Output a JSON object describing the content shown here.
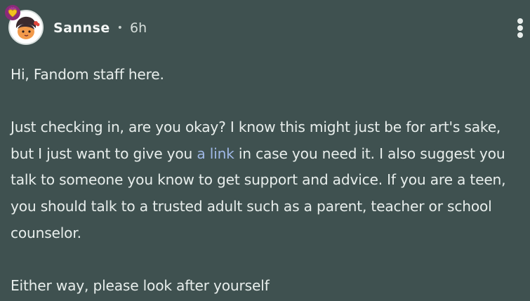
{
  "post": {
    "username": "Sannse",
    "separator": "•",
    "time_ago": "6h",
    "more_icon": "more-vertical-icon",
    "avatar_icon": "avatar-character-icon",
    "badge_icon": "heart-badge-icon",
    "colors": {
      "background": "#3f5150",
      "text": "#e8eeec",
      "link": "#9fb8e6",
      "badge": "#8a2a7a"
    }
  },
  "message": {
    "greeting": "Hi, Fandom staff here.",
    "para1_before_link": "Just checking in, are you okay? I know this might just be for art's sake, but I just want to give you ",
    "link_text": "a link",
    "para1_after_link": " in case you need it. I also suggest you talk to someone you know to get support and advice. If you are a teen, you should talk to a trusted adult such as a parent, teacher or school counselor.",
    "closing": "Either way, please look after yourself"
  }
}
